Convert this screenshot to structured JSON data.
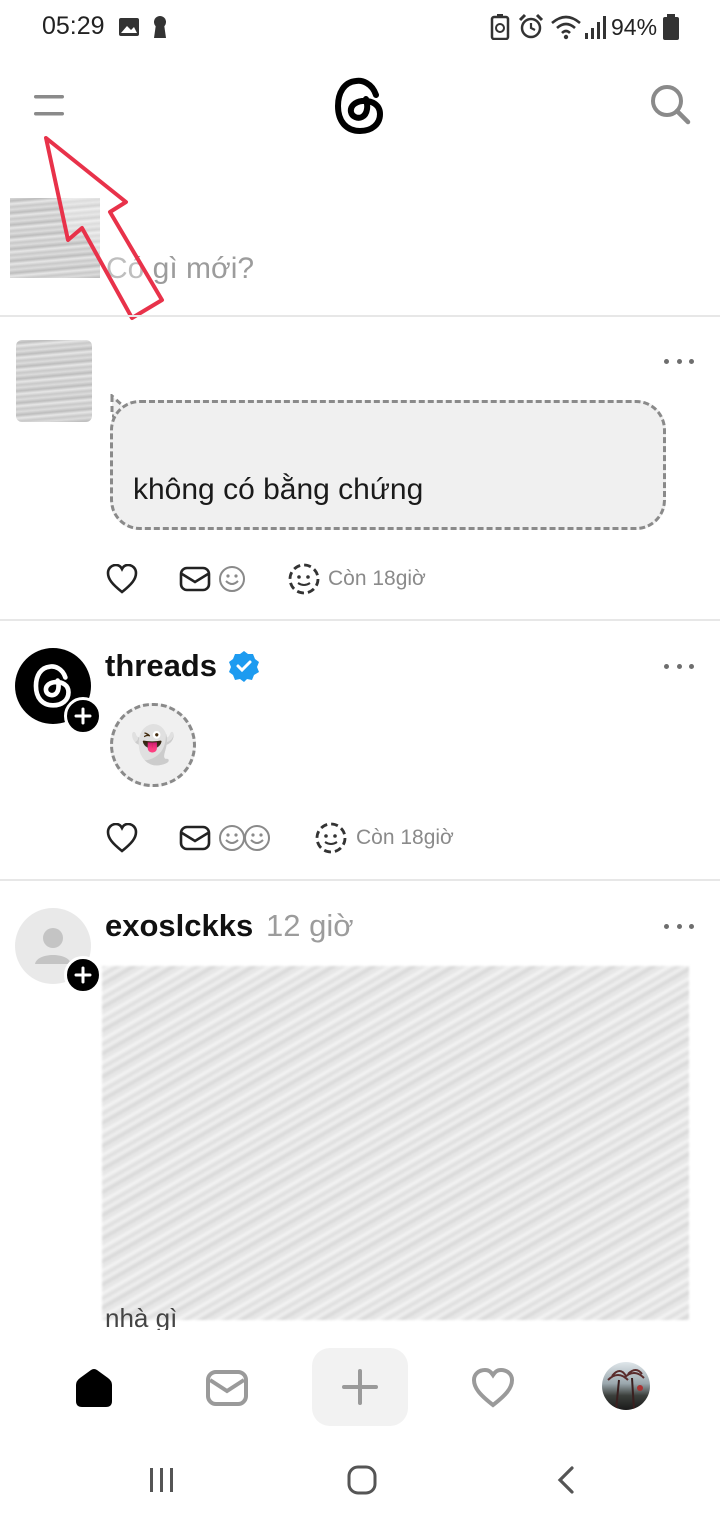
{
  "status_bar": {
    "time": "05:29",
    "battery_percent": "94%",
    "icons": [
      "image-icon",
      "keyhole-icon",
      "battery-saver-icon",
      "alarm-icon",
      "wifi-icon",
      "signal-icon",
      "battery-icon"
    ]
  },
  "header": {
    "menu_icon": "hamburger-menu-icon",
    "logo_icon": "threads-logo-icon",
    "search_icon": "search-icon"
  },
  "composer": {
    "placeholder": "Có gì mới?"
  },
  "posts": [
    {
      "type": "note",
      "note_text": "không có bằng chứng",
      "remaining": "Còn 18giờ"
    },
    {
      "type": "note",
      "username": "threads",
      "verified": true,
      "note_emoji": "👻",
      "remaining": "Còn 18giờ"
    },
    {
      "type": "post",
      "username": "exoslckks",
      "time": "12 giờ",
      "partial_text_bottom": "nhà gì"
    }
  ],
  "bottom_nav": {
    "items": [
      "home-icon",
      "inbox-icon",
      "create-plus-icon",
      "activity-heart-icon",
      "profile-avatar"
    ]
  },
  "system_nav": {
    "items": [
      "recents-icon",
      "home-circle-icon",
      "back-icon"
    ]
  },
  "colors": {
    "annotation_arrow": "#e8324a",
    "verified_badge": "#1d9bf0"
  }
}
